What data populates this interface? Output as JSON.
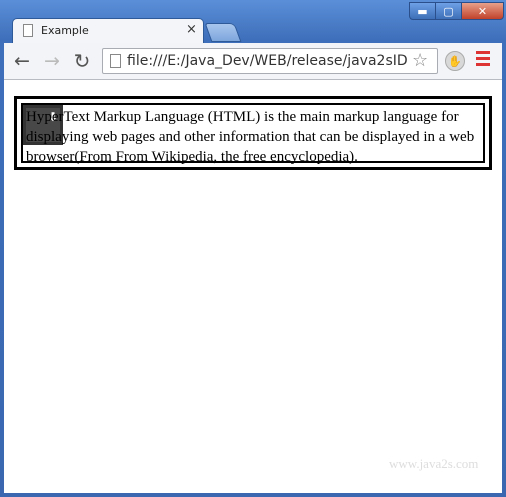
{
  "window": {
    "min_label": "▬",
    "max_label": "▢",
    "close_label": "✕"
  },
  "tab": {
    "title": "Example",
    "close_label": "×"
  },
  "toolbar": {
    "back_label": "←",
    "forward_label": "→",
    "reload_label": "↻",
    "url": "file:///E:/Java_Dev/WEB/release/java2sID",
    "star_label": "☆",
    "ext_label": "✋"
  },
  "content": {
    "paragraph": "HyperText Markup Language (HTML) is the main markup language for displaying web pages and other information that can be displayed in a web browser(From From Wikipedia, the free encyclopedia).",
    "badge_glyph": "⬇"
  },
  "watermark": "www.java2s.com"
}
